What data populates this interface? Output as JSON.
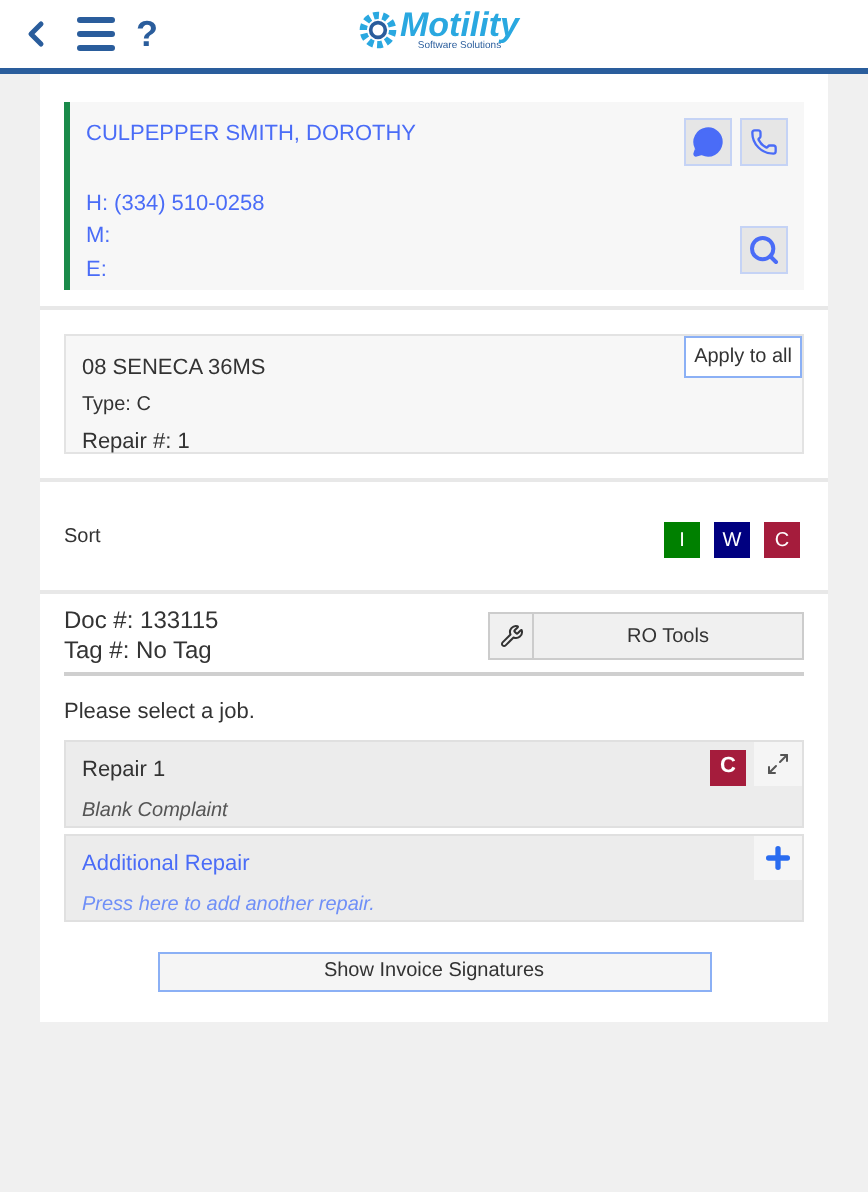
{
  "header": {
    "help": "?",
    "logo": {
      "name": "Motility",
      "tagline": "Software Solutions"
    }
  },
  "customer": {
    "name": "CULPEPPER SMITH, DOROTHY",
    "home": "H: (334) 510-0258",
    "mobile": "M:",
    "email": "E:"
  },
  "unit": {
    "title": "08 SENECA 36MS",
    "type": "Type: C",
    "repair": "Repair #: 1",
    "apply_button": "Apply to all"
  },
  "sort": {
    "label": "Sort",
    "badges": [
      {
        "label": "I",
        "color": "#008000"
      },
      {
        "label": "W",
        "color": "#000080"
      },
      {
        "label": "C",
        "color": "#a51c3c"
      }
    ]
  },
  "doc": {
    "doc_number": "Doc #: 133115",
    "tag_number": "Tag #: No Tag",
    "tools_button": "RO Tools"
  },
  "prompt": "Please select a job.",
  "jobs": [
    {
      "kind": "repair",
      "title": "Repair 1",
      "subtitle": "Blank Complaint",
      "badge": {
        "label": "C",
        "color": "#a51c3c"
      }
    },
    {
      "kind": "add",
      "title": "Additional Repair",
      "subtitle": "Press here to add another repair."
    }
  ],
  "signatures_button": "Show Invoice Signatures"
}
